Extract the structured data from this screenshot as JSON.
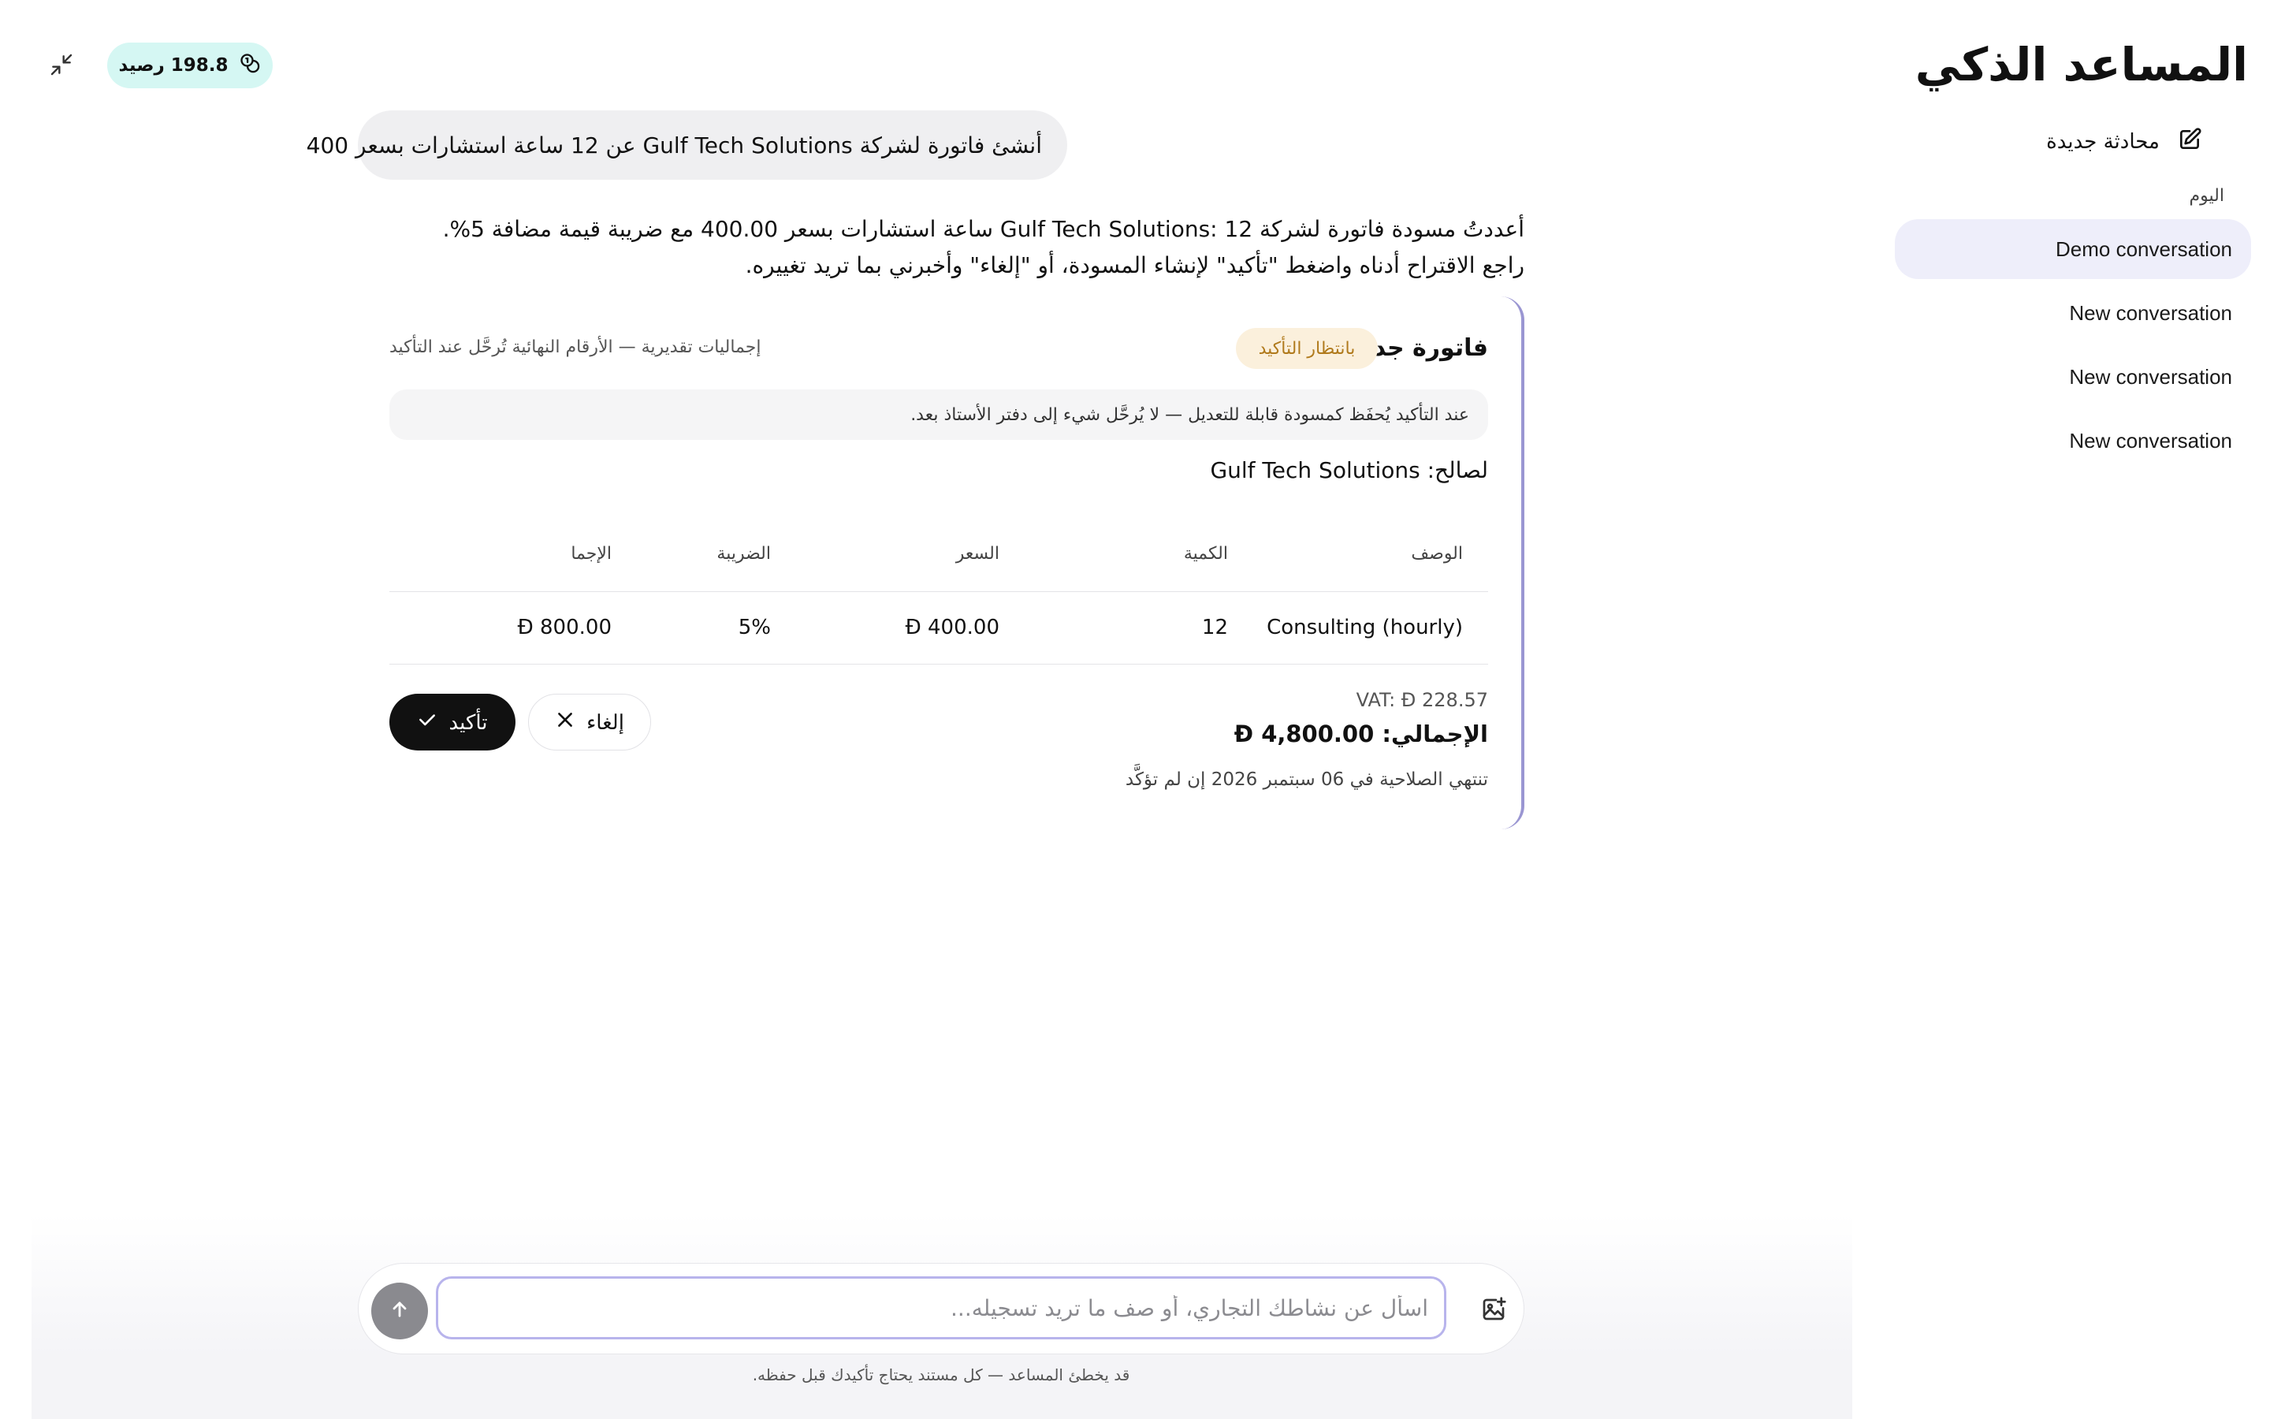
{
  "sidebar": {
    "title": "المساعد الذكي",
    "new_chat_label": "محادثة جديدة",
    "section_label": "اليوم",
    "conversations": [
      {
        "label": "Demo conversation",
        "active": true
      },
      {
        "label": "New conversation",
        "active": false
      },
      {
        "label": "New conversation",
        "active": false
      },
      {
        "label": "New conversation",
        "active": false
      }
    ]
  },
  "header": {
    "credits_label": "198.8 رصيد",
    "credits_icon": "coins-icon",
    "collapse_icon": "collapse-icon"
  },
  "chat": {
    "user_message": "أنشئ فاتورة لشركة Gulf Tech Solutions عن 12 ساعة استشارات بسعر 400",
    "assistant_message": "أعددتُ مسودة فاتورة لشركة Gulf Tech Solutions: 12 ساعة استشارات بسعر 400.00 مع ضريبة قيمة مضافة 5%. راجع الاقتراح أدناه واضغط \"تأكيد\" لإنشاء المسودة، أو \"إلغاء\" وأخبرني بما تريد تغييره."
  },
  "invoice_card": {
    "title": "فاتورة جديدة",
    "status_badge": "بانتظار التأكيد",
    "estimate_note": "إجماليات تقديرية — الأرقام النهائية تُرحَّل عند التأكيد",
    "info_text": "عند التأكيد يُحفَظ كمسودة قابلة للتعديل — لا يُرحَّل شيء إلى دفتر الأستاذ بعد.",
    "customer_line": "لصالح: Gulf Tech Solutions",
    "columns": {
      "description": "الوصف",
      "quantity": "الكمية",
      "price": "السعر",
      "tax": "الضريبة",
      "total": "الإجما"
    },
    "rows": [
      {
        "description": "Consulting (hourly)",
        "quantity": "12",
        "price": "400.00",
        "tax": "5%",
        "total": "800.00"
      }
    ],
    "currency_symbol": "Đ",
    "vat_line": "VAT: Đ 228.57",
    "total_label": "الإجمالي:",
    "total_value": "4,800.00",
    "expiry_line": "تنتهي الصلاحية في 06 سبتمبر 2026 إن لم تؤكَّد",
    "confirm_label": "تأكيد",
    "cancel_label": "إلغاء"
  },
  "composer": {
    "placeholder": "اسأل عن نشاطك التجاري، أو صف ما تريد تسجيله...",
    "value": "",
    "disclaimer": "قد يخطئ المساعد — كل مستند يحتاج تأكيدك قبل حفظه."
  },
  "colors": {
    "accent": "#9a96d2",
    "credit_pill_bg": "#d5f7f3",
    "pending_badge_bg": "#fbf0dc",
    "pending_badge_text": "#b07a1c",
    "active_conversation_bg": "#eeeefa",
    "confirm_button_bg": "#111111"
  }
}
